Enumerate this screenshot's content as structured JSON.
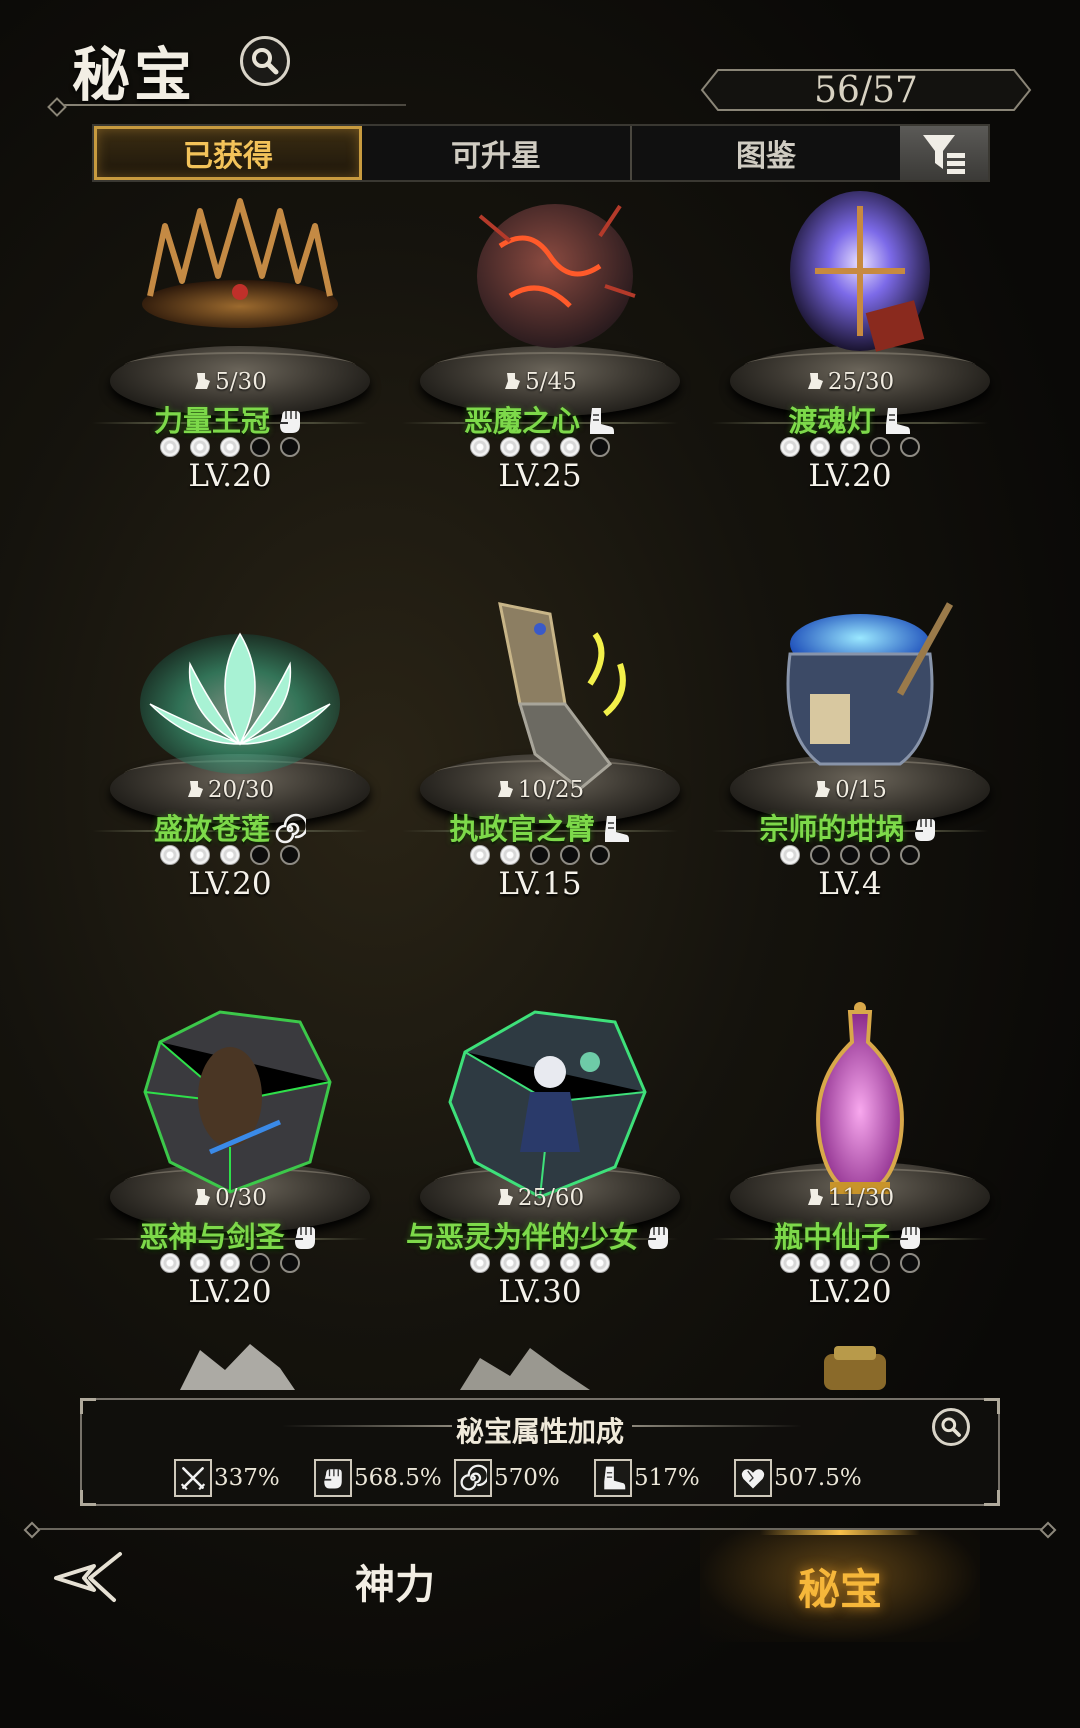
{
  "header": {
    "title": "秘宝",
    "count": "56/57"
  },
  "tabs": [
    {
      "label": "已获得"
    },
    {
      "label": "可升星"
    },
    {
      "label": "图鉴"
    }
  ],
  "items": [
    {
      "name": "力量王冠",
      "fragments": "5/30",
      "level": "LV.20",
      "stars_filled": 3,
      "stars_total": 5,
      "class_icon": "fist-icon"
    },
    {
      "name": "恶魔之心",
      "fragments": "5/45",
      "level": "LV.25",
      "stars_filled": 4,
      "stars_total": 5,
      "class_icon": "boot-icon"
    },
    {
      "name": "渡魂灯",
      "fragments": "25/30",
      "level": "LV.20",
      "stars_filled": 3,
      "stars_total": 5,
      "class_icon": "boot-icon"
    },
    {
      "name": "盛放苍莲",
      "fragments": "20/30",
      "level": "LV.20",
      "stars_filled": 3,
      "stars_total": 5,
      "class_icon": "swirl-icon"
    },
    {
      "name": "执政官之臂",
      "fragments": "10/25",
      "level": "LV.15",
      "stars_filled": 2,
      "stars_total": 5,
      "class_icon": "boot-icon"
    },
    {
      "name": "宗师的坩埚",
      "fragments": "0/15",
      "level": "LV.4",
      "stars_filled": 1,
      "stars_total": 5,
      "class_icon": "fist-icon"
    },
    {
      "name": "恶神与剑圣",
      "fragments": "0/30",
      "level": "LV.20",
      "stars_filled": 3,
      "stars_total": 5,
      "class_icon": "fist-icon"
    },
    {
      "name": "与恶灵为伴的少女",
      "fragments": "25/60",
      "level": "LV.30",
      "stars_filled": 5,
      "stars_total": 5,
      "class_icon": "fist-icon"
    },
    {
      "name": "瓶中仙子",
      "fragments": "11/30",
      "level": "LV.20",
      "stars_filled": 3,
      "stars_total": 5,
      "class_icon": "fist-icon"
    }
  ],
  "bonus": {
    "title": "秘宝属性加成",
    "stats": [
      {
        "icon": "swords-icon",
        "value": "337%"
      },
      {
        "icon": "fist-icon",
        "value": "568.5%"
      },
      {
        "icon": "swirl-icon",
        "value": "570%"
      },
      {
        "icon": "boot-icon",
        "value": "517%"
      },
      {
        "icon": "heart-icon",
        "value": "507.5%"
      }
    ]
  },
  "nav": {
    "power": "神力",
    "secret": "秘宝"
  },
  "colors": {
    "accent_gold": "#f6b73a",
    "item_name_green": "#7dd94a",
    "tab_active": "#f3c35a"
  }
}
